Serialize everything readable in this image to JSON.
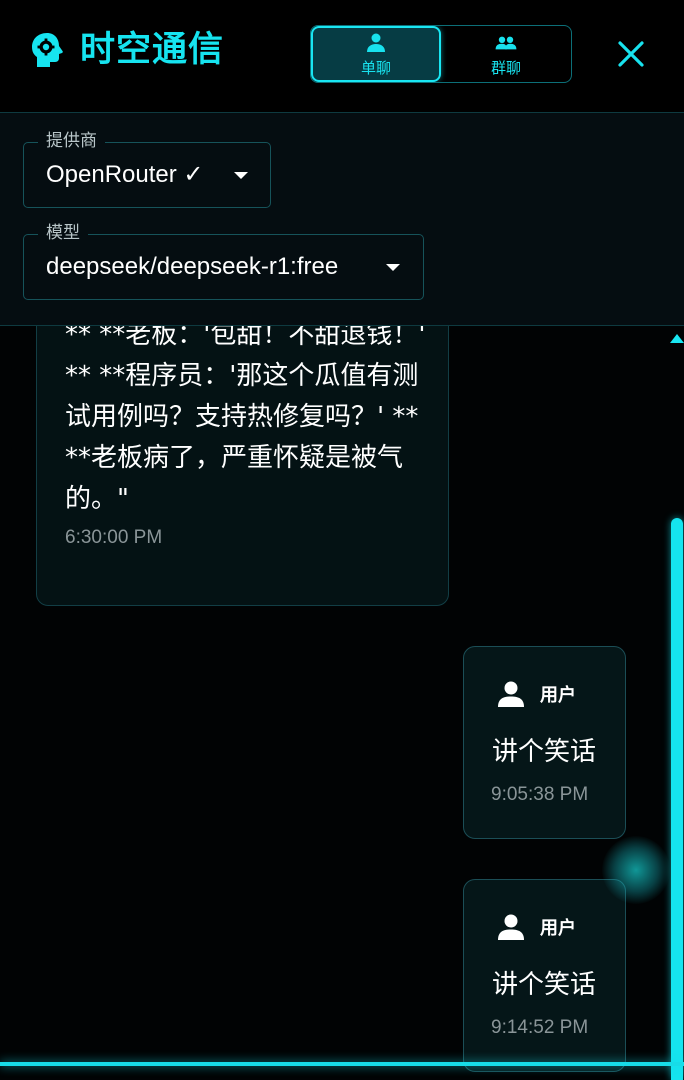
{
  "header": {
    "title": "时空通信",
    "brand_icon": "head-gear-icon",
    "modes": [
      {
        "label": "单聊",
        "icon": "person-icon",
        "active": true
      },
      {
        "label": "群聊",
        "icon": "group-icon",
        "active": false
      }
    ],
    "close_icon": "close-icon",
    "accent_color": "#16e4f0"
  },
  "settings": {
    "provider": {
      "label": "提供商",
      "value": "OpenRouter ✓"
    },
    "model": {
      "label": "模型",
      "value": "deepseek/deepseek-r1:free"
    }
  },
  "messages": [
    {
      "role": "assistant",
      "lines": [
        "** **老板：'包甜！不甜退钱！'",
        "** **程序员：'那这个瓜值有测",
        "试用例吗？支持热修复吗？' **",
        "**老板病了，严重怀疑是被气",
        "的。\""
      ],
      "time": "6:30:00 PM"
    },
    {
      "role": "user",
      "sender": "用户",
      "text": "讲个笑话",
      "time": "9:05:38 PM"
    },
    {
      "role": "user",
      "sender": "用户",
      "text": "讲个笑话",
      "time": "9:14:52 PM"
    }
  ]
}
